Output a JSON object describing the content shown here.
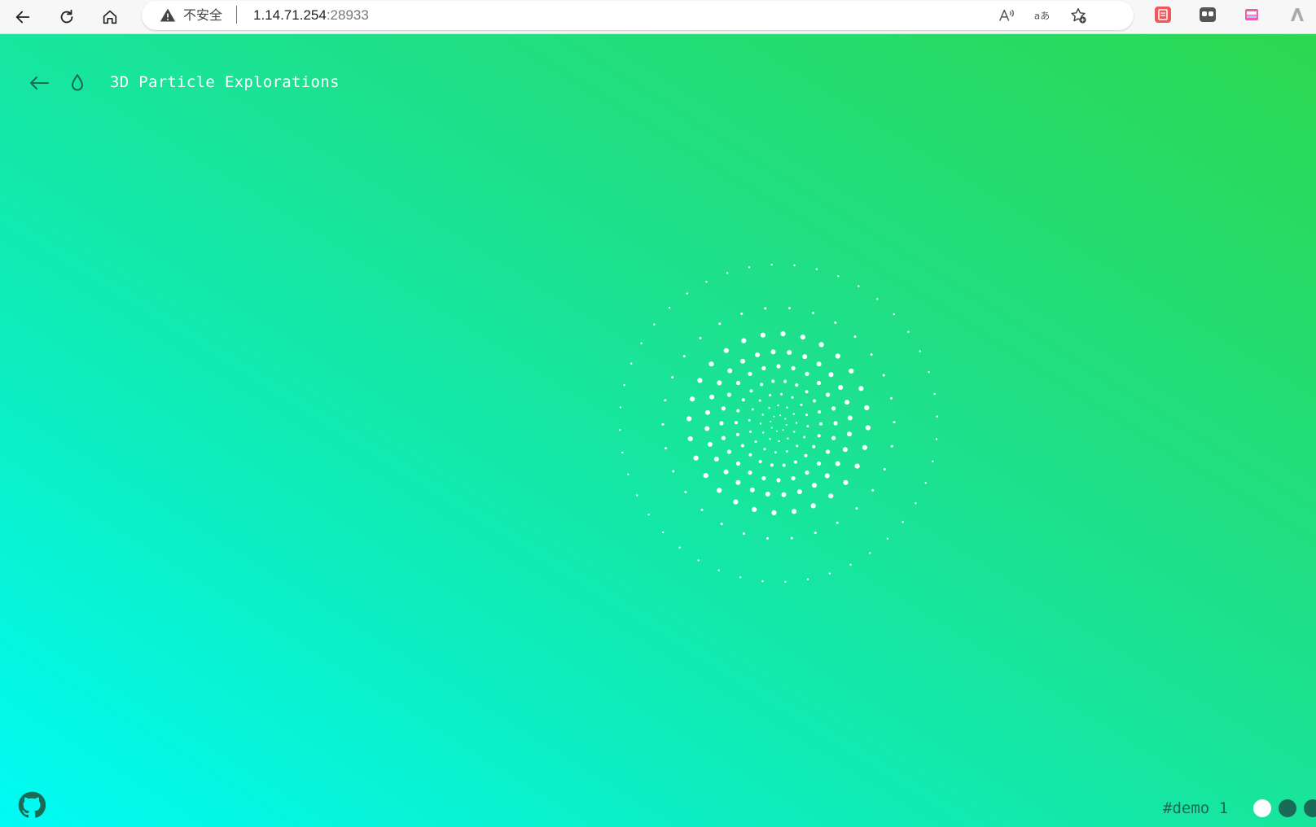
{
  "browser": {
    "insecure_label": "不安全",
    "url_host": "1.14.71.254",
    "url_port": ":28933",
    "icons": [
      "back-icon",
      "reload-icon",
      "home-icon",
      "warning-icon",
      "read-aloud-icon",
      "translate-icon",
      "favorite-add-icon",
      "extension-red-icon",
      "extension-gray-icon",
      "extension-pink-icon",
      "extension-a-icon"
    ]
  },
  "page": {
    "title": "3D Particle Explorations",
    "demo_label": "#demo 1",
    "background_colors": [
      "#00fbf5",
      "#11eab0",
      "#1ee08a",
      "#2dd850"
    ],
    "accent_dark": "#1a6b55",
    "particle_color": "#ffffff",
    "demo_dots": [
      {
        "name": "demo-dot-1",
        "color": "#ffffff",
        "active": true
      },
      {
        "name": "demo-dot-2",
        "color": "#1a6b55",
        "active": false
      },
      {
        "name": "demo-dot-3",
        "color": "#1a6b55",
        "active": false
      }
    ]
  }
}
